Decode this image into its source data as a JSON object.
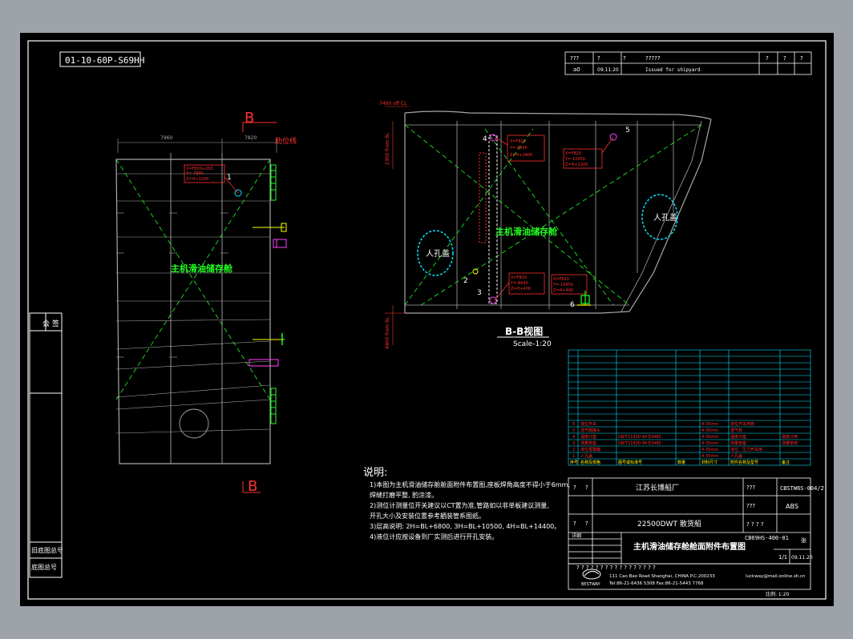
{
  "drawing_code_mirrored": "01-10-60P-S69HH",
  "left_panel": {
    "cell_1": "会 签",
    "cell_2": "旧底图总号",
    "cell_3": "底图总号"
  },
  "revision_block": {
    "row1": [
      "???",
      "?",
      "?",
      "?????",
      "?",
      "?",
      "?"
    ],
    "row2": [
      "a0",
      "09.11.20",
      "Issued for shipyard"
    ]
  },
  "section_marker": "B",
  "left_dims": [
    "7960",
    "7820"
  ],
  "label_main_tank": "主机滑油储存舱",
  "label_bulkhead": "肋位线",
  "callouts": [
    "1",
    "2",
    "3",
    "4",
    "5",
    "6"
  ],
  "coord_boxes": {
    "c1": [
      "X=F820+250",
      "Y=-7800",
      "Z=H+1200"
    ],
    "c4": [
      "X=F820",
      "Y=-8640",
      "Z=H+2400"
    ],
    "c5": [
      "X=F820",
      "Y=-10450",
      "Z=H+1200"
    ],
    "c2": [
      "X=F820",
      "Y=-8640",
      "Z=H+400"
    ],
    "c3": [
      "X=F820",
      "Y=-8640",
      "Z=H+400"
    ],
    "c6": [
      "X=F820",
      "Y=-10450",
      "Z=H+400"
    ]
  },
  "right_dims": [
    "7400 off CL",
    "2300 from BL",
    "4400 from BL"
  ],
  "manhole_label": "人孔盖",
  "view_title": "B-B视图",
  "view_scale": "Scale-1:20",
  "notes": {
    "title": "说明:",
    "lines": [
      "1)本图为主机滑油储存舱舱面附件布置图,座板焊角高度不得小于6mm,",
      "   焊缝打磨平整, 酌涂漆。",
      "2)测位计测量位开关建议以CT置为准,管路如以非单板建议测量,",
      "   开孔大小及安装位置参考舾装管系图纸。",
      "3)层高说明: 2H=BL+6800, 3H=BL+10500, 4H=BL+14400。",
      "4)液位计应按设备到厂实测后进行开孔安装。"
    ]
  },
  "parts_list": {
    "rows": [
      [
        "6",
        "液位开关",
        "",
        "",
        "4-35mm",
        "液位开关用管",
        ""
      ],
      [
        "5",
        "透气帽接头",
        "",
        "",
        "4-35mm",
        "透气管",
        ""
      ],
      [
        "4",
        "温度计座",
        "GB/T11930-94 E3480",
        "",
        "4-35mm",
        "温度计座",
        "温度计用"
      ],
      [
        "3",
        "测量管座",
        "GB/T11930-94 E3480",
        "",
        "4-35mm",
        "测量管座",
        "测量管用"
      ],
      [
        "2",
        "液位报警器",
        "",
        "",
        "4-35mm",
        "液位、压力开关用",
        ""
      ],
      [
        "1",
        "人孔盖",
        "",
        "",
        "4-35mm",
        "人孔盖",
        ""
      ]
    ],
    "header": [
      "序号",
      "名称及规格",
      "图号或标准号",
      "数量",
      "材料尺寸",
      "附件名称及型号",
      "备注"
    ]
  },
  "title_block": {
    "company": "江苏长博船厂",
    "drawing_no": "CBSTW6S-004/2",
    "class": "ABS",
    "ship": "22500DWT 散货船",
    "drawing_code": "CB69HS-400-01",
    "sheet_title": "主机滑油储存舱舱面附件布置图",
    "sheet": "1/1",
    "date": "09.11.20",
    "sheet_label": "张",
    "stage": "详细",
    "q": "?",
    "qq": "???",
    "qqqq": "? ? ? ?",
    "designer_line": "? ? ? ? ? ? ? ? ? ? ? ? ? ? ? ? ?",
    "logo_text": "BESTWAY",
    "address": "111 Cao Bao Road Shanghai, CHINA   P.C:200233",
    "phone": "Tel:86-21-6436 5308  Fax:86-21-5443 7768",
    "email": "luckway@mail.online.sh.cn",
    "scale_label": "比例: 1:20"
  },
  "colors": {
    "sheet": "#000000",
    "frame": "#ffffff",
    "grey": "#a8a8a8",
    "red": "#ff3030",
    "green": "#20ff20",
    "cyan": "#00e5ff",
    "yellow": "#ffff00",
    "magenta": "#ff40ff"
  }
}
